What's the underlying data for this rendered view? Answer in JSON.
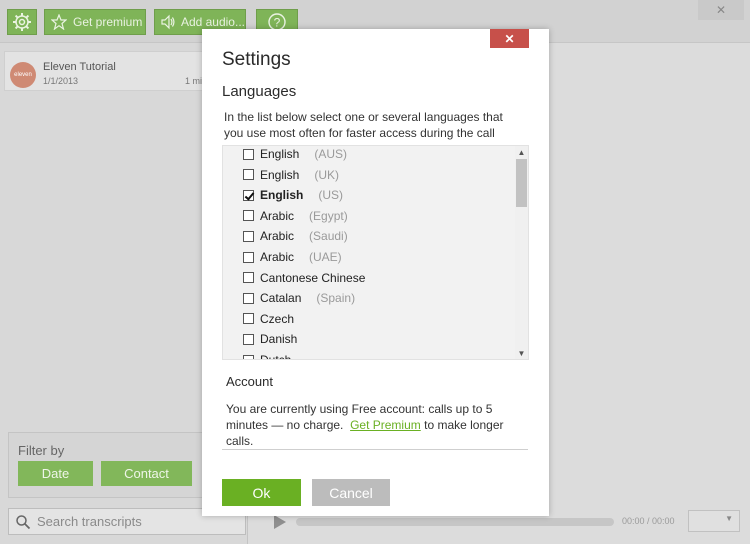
{
  "colors": {
    "accent": "#6ab023",
    "close": "#c7504a",
    "cancel": "#bcbcbc"
  },
  "toolbar": {
    "settings_icon": "gear-icon",
    "premium_label": "Get premium",
    "premium_icon": "star-icon",
    "audio_label": "Add audio...",
    "audio_icon": "speaker-icon",
    "help_label": "?",
    "close_glyph": "✕"
  },
  "recording": {
    "logo_text": "eleven",
    "title": "Eleven Tutorial",
    "date": "1/1/2013",
    "duration": "1 mi"
  },
  "filter": {
    "label": "Filter by",
    "date_label": "Date",
    "contact_label": "Contact"
  },
  "search": {
    "placeholder": "Search transcripts",
    "icon": "search-icon"
  },
  "player": {
    "time": "00:00 / 00:00"
  },
  "modal": {
    "title": "Settings",
    "close_glyph": "✕",
    "languages_heading": "Languages",
    "languages_desc": "In the list below select one or several languages that you use most often for faster access during the call",
    "languages": [
      {
        "name": "English",
        "region": "(AUS)",
        "checked": false
      },
      {
        "name": "English",
        "region": "(UK)",
        "checked": false
      },
      {
        "name": "English",
        "region": "(US)",
        "checked": true
      },
      {
        "name": "Arabic",
        "region": "(Egypt)",
        "checked": false
      },
      {
        "name": "Arabic",
        "region": "(Saudi)",
        "checked": false
      },
      {
        "name": "Arabic",
        "region": "(UAE)",
        "checked": false
      },
      {
        "name": "Cantonese Chinese",
        "region": "",
        "checked": false
      },
      {
        "name": "Catalan",
        "region": "(Spain)",
        "checked": false
      },
      {
        "name": "Czech",
        "region": "",
        "checked": false
      },
      {
        "name": "Danish",
        "region": "",
        "checked": false
      },
      {
        "name": "Dutch",
        "region": "",
        "checked": false
      }
    ],
    "scroll_up": "▲",
    "scroll_down": "▼",
    "account_heading": "Account",
    "account_text_1": "You are currently using Free account: calls up to 5 minutes — no charge.",
    "account_link": "Get Premium",
    "account_text_2": "to make longer calls.",
    "ok_label": "Ok",
    "cancel_label": "Cancel"
  }
}
